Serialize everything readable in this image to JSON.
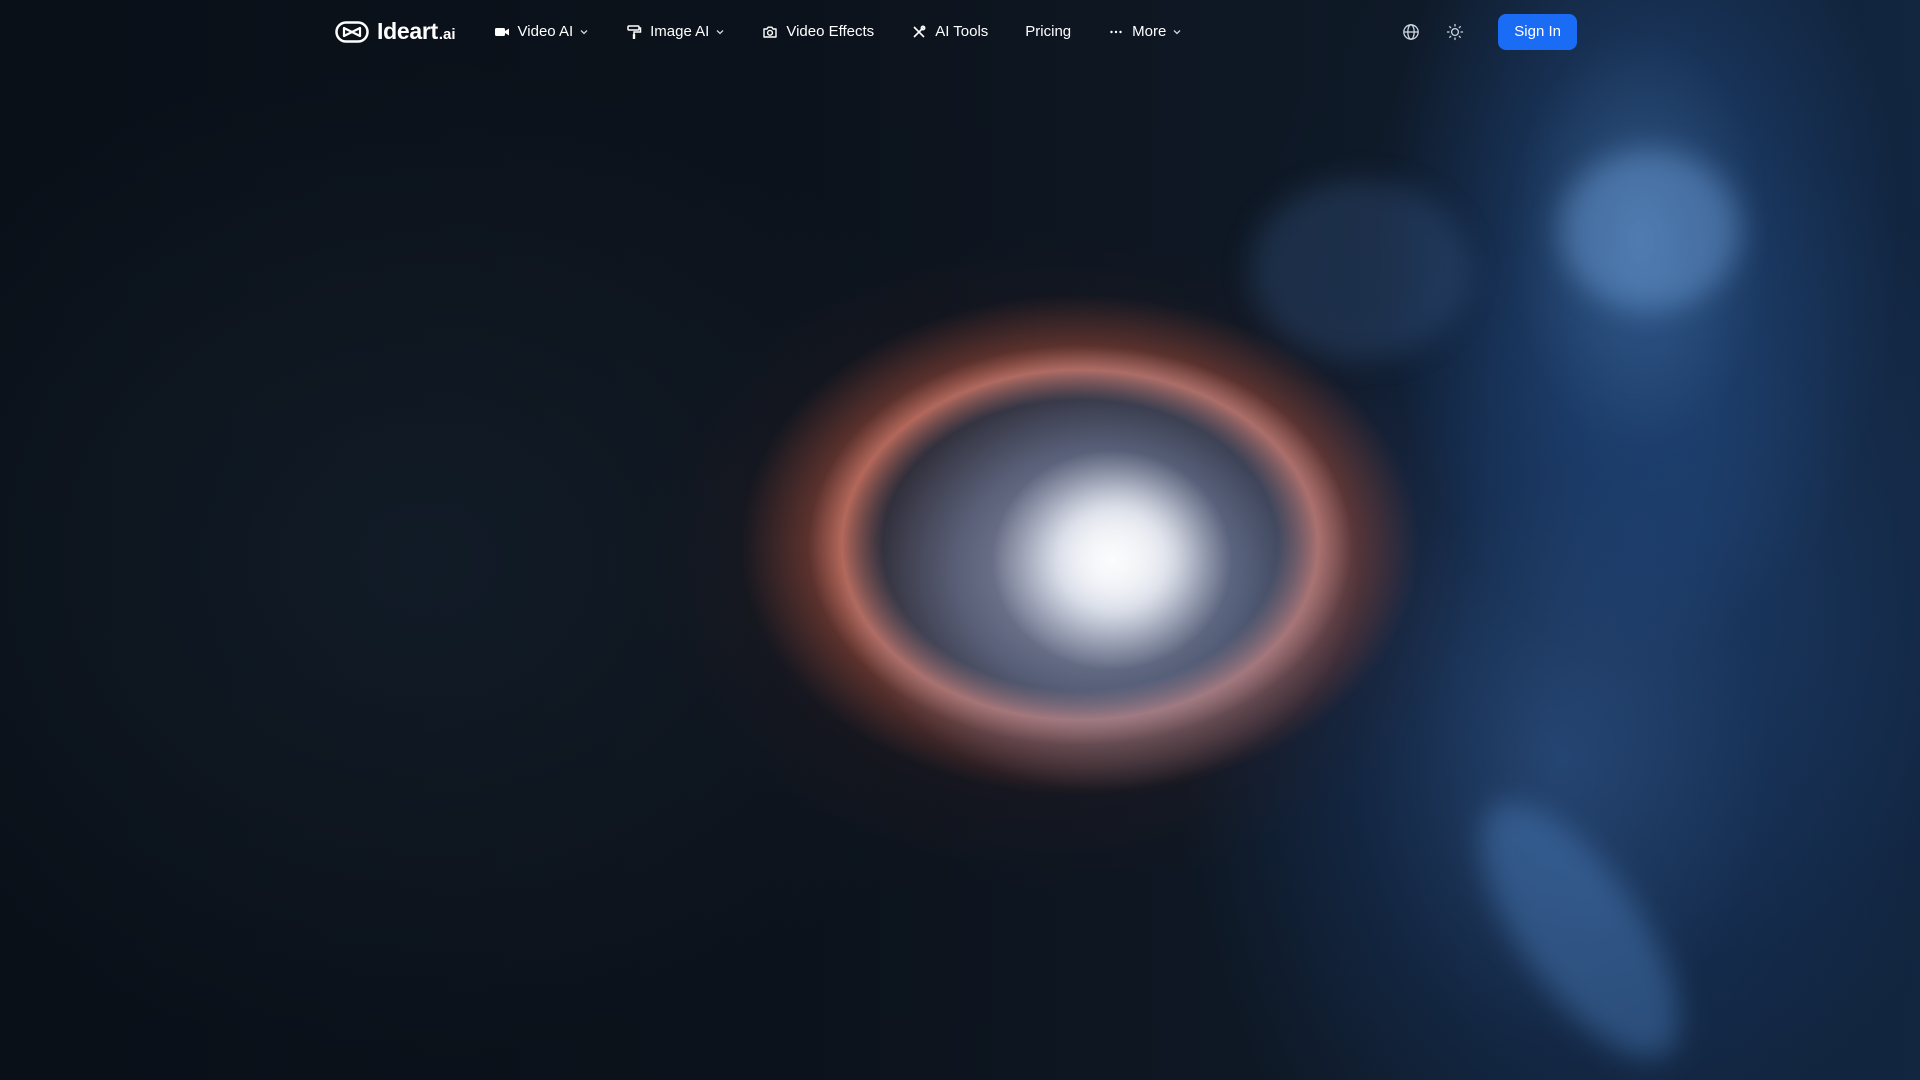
{
  "brand": {
    "name": "Ideart",
    "suffix": ".ai",
    "logo_icon": "play-eye-logo"
  },
  "nav": {
    "items": [
      {
        "label": "Video AI",
        "icon": "video-camera-icon",
        "has_dropdown": true
      },
      {
        "label": "Image AI",
        "icon": "paint-roller-icon",
        "has_dropdown": true
      },
      {
        "label": "Video Effects",
        "icon": "camera-icon",
        "has_dropdown": false
      },
      {
        "label": "AI Tools",
        "icon": "tools-icon",
        "has_dropdown": false
      },
      {
        "label": "Pricing",
        "icon": "",
        "has_dropdown": false
      },
      {
        "label": "More",
        "icon": "ellipsis-icon",
        "has_dropdown": true
      }
    ]
  },
  "header_actions": {
    "language_icon": "globe-icon",
    "theme_icon": "sun-icon",
    "signin_label": "Sign In"
  },
  "colors": {
    "accent": "#1a6cf5",
    "background": "#0b0f17",
    "text": "#ffffff"
  },
  "hero": {
    "visual": "nebula-explosion-video"
  }
}
